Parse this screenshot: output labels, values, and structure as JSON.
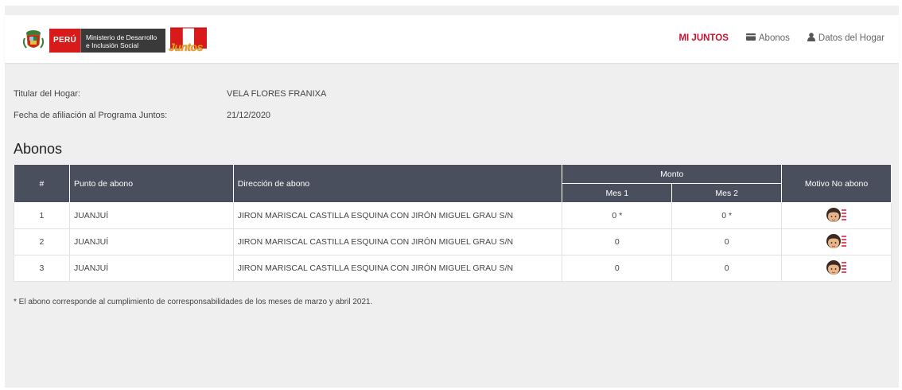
{
  "header": {
    "peru_label": "PERÚ",
    "ministerio_line1": "Ministerio de Desarrollo",
    "ministerio_line2": "e Inclusión Social",
    "juntos_label": "Juntos",
    "nav": [
      {
        "label": "MI JUNTOS",
        "icon": "none",
        "active": true
      },
      {
        "label": "Abonos",
        "icon": "card-icon",
        "active": false
      },
      {
        "label": "Datos del Hogar",
        "icon": "user-icon",
        "active": false
      }
    ]
  },
  "info": {
    "titular_label": "Titular del Hogar:",
    "titular_value": "VELA FLORES FRANIXA",
    "fecha_label": "Fecha de afiliación al Programa Juntos:",
    "fecha_value": "21/12/2020"
  },
  "abonos": {
    "title": "Abonos",
    "headers": {
      "num": "#",
      "punto": "Punto de abono",
      "direccion": "Dirección de abono",
      "monto": "Monto",
      "mes1": "Mes 1",
      "mes2": "Mes 2",
      "motivo": "Motivo No abono"
    },
    "rows": [
      {
        "num": "1",
        "punto": "JUANJUÍ",
        "direccion": "JIRON MARISCAL CASTILLA ESQUINA CON JIRÓN MIGUEL GRAU S/N",
        "mes1": "0 *",
        "mes2": "0 *",
        "motivo_icon": "person-list-icon"
      },
      {
        "num": "2",
        "punto": "JUANJUÍ",
        "direccion": "JIRON MARISCAL CASTILLA ESQUINA CON JIRÓN MIGUEL GRAU S/N",
        "mes1": "0",
        "mes2": "0",
        "motivo_icon": "person-list-icon"
      },
      {
        "num": "3",
        "punto": "JUANJUÍ",
        "direccion": "JIRON MARISCAL CASTILLA ESQUINA CON JIRÓN MIGUEL GRAU S/N",
        "mes1": "0",
        "mes2": "0",
        "motivo_icon": "person-list-icon"
      }
    ],
    "footnote": "* El abono corresponde al cumplimiento de corresponsabilidades de los meses de marzo y abril 2021."
  },
  "colors": {
    "accent": "#c8102e",
    "table_header": "#4a4f5e",
    "peru_red": "#d91a1a",
    "background": "#efefef"
  }
}
